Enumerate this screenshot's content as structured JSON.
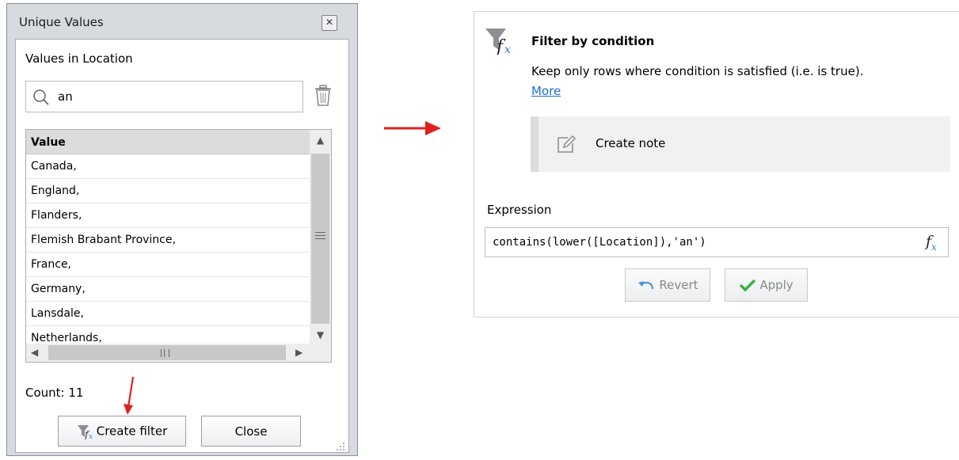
{
  "unique_values": {
    "title": "Unique Values",
    "close_icon": "close-icon",
    "caption": "Values in Location",
    "search": {
      "value": "an",
      "placeholder": ""
    },
    "grid": {
      "header": "Value",
      "rows": [
        "Canada,",
        "England,",
        "Flanders,",
        "Flemish Brabant Province,",
        "France,",
        "Germany,",
        "Lansdale,",
        "Netherlands,"
      ]
    },
    "count": "Count: 11",
    "create_filter_label": "Create filter",
    "close_label": "Close"
  },
  "filter_panel": {
    "title": "Filter by condition",
    "description": "Keep only rows where condition is satisfied (i.e. is true).",
    "more_link": "More",
    "note_label": "Create note",
    "expression_label": "Expression",
    "expression_value": "contains(lower([Location]),'an')",
    "revert_label": "Revert",
    "apply_label": "Apply"
  },
  "colors": {
    "annotation_arrow": "#e02020",
    "link": "#1a6fd6",
    "apply_check": "#3cb043"
  }
}
